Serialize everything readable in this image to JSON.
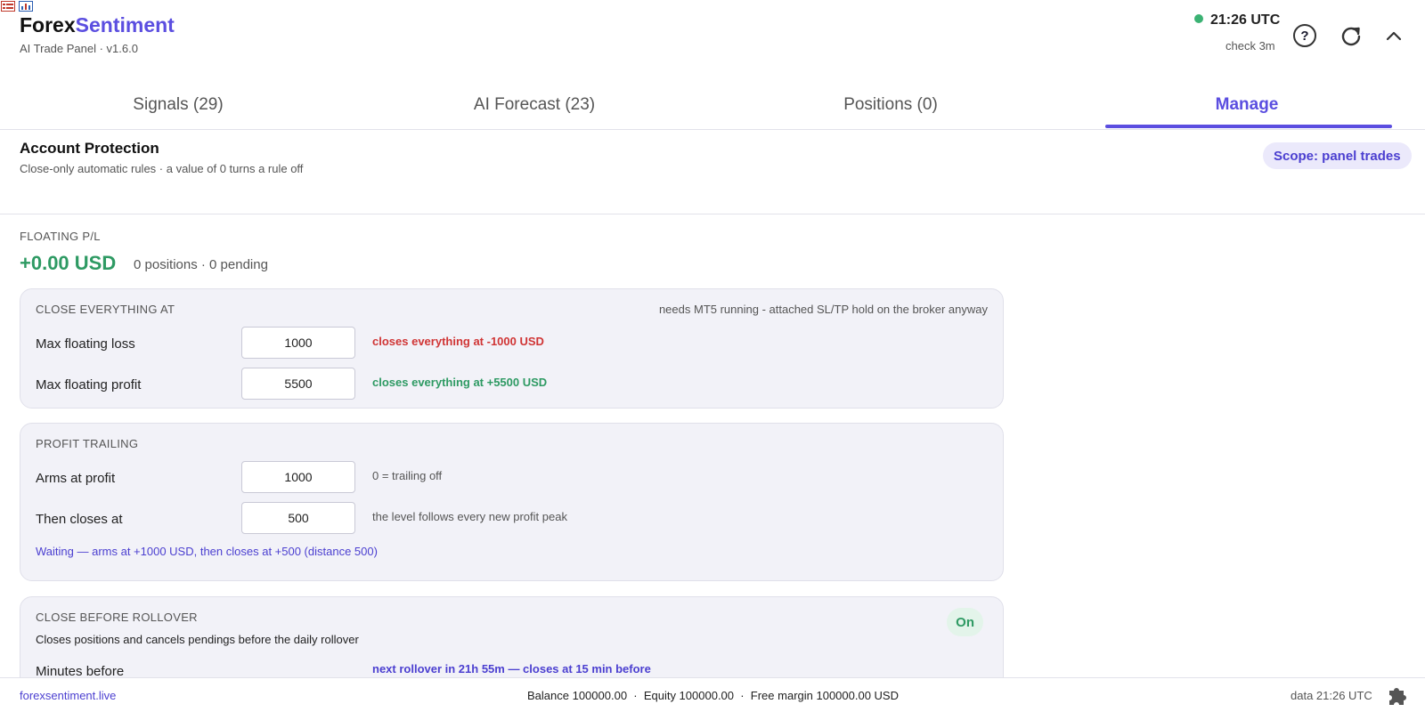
{
  "header": {
    "brand_main": "Forex",
    "brand_accent": "Sentiment",
    "subtitle": "AI Trade Panel · v1.6.0",
    "time": "21:26 UTC",
    "check": "check 3m",
    "help_label": "?",
    "status_color": "#3bb273",
    "icons": [
      "help-icon",
      "refresh-icon",
      "chevron-up-icon"
    ]
  },
  "tabs": [
    {
      "label": "Signals (29)",
      "active": false
    },
    {
      "label": "AI Forecast (23)",
      "active": false
    },
    {
      "label": "Positions (0)",
      "active": false
    },
    {
      "label": "Manage",
      "active": true
    }
  ],
  "section": {
    "title": "Account Protection",
    "subtitle": "Close-only automatic rules · a value of 0 turns a rule off",
    "scope": "Scope: panel trades"
  },
  "floating": {
    "label": "FLOATING P/L",
    "value": "+0.00 USD",
    "meta": "0 positions · 0 pending"
  },
  "close_all": {
    "title": "CLOSE EVERYTHING AT",
    "note": "needs MT5 running - attached SL/TP hold on the broker anyway",
    "loss_label": "Max floating loss",
    "loss_value": "1000",
    "loss_hint": "closes everything at -1000 USD",
    "profit_label": "Max floating profit",
    "profit_value": "5500",
    "profit_hint": "closes everything at +5500 USD"
  },
  "trailing": {
    "title": "PROFIT TRAILING",
    "arms_label": "Arms at profit",
    "arms_value": "1000",
    "arms_hint": "0 = trailing off",
    "close_label": "Then closes at",
    "close_value": "500",
    "close_hint": "the level follows every new profit peak",
    "status": "Waiting — arms at +1000 USD, then closes at +500 (distance 500)"
  },
  "rollover": {
    "title": "CLOSE BEFORE ROLLOVER",
    "toggle": "On",
    "description": "Closes positions and cancels pendings before the daily rollover",
    "minutes_label": "Minutes before",
    "minutes_hint": "next rollover in 21h 55m — closes at 15 min before"
  },
  "footer": {
    "site": "forexsentiment.live",
    "account": "Balance 100000.00  ·  Equity 100000.00  ·  Free margin 100000.00 USD",
    "data_time": "data 21:26 UTC"
  },
  "colors": {
    "accent": "#5b4ee0",
    "profit": "#2e9a63",
    "loss": "#d03535"
  }
}
